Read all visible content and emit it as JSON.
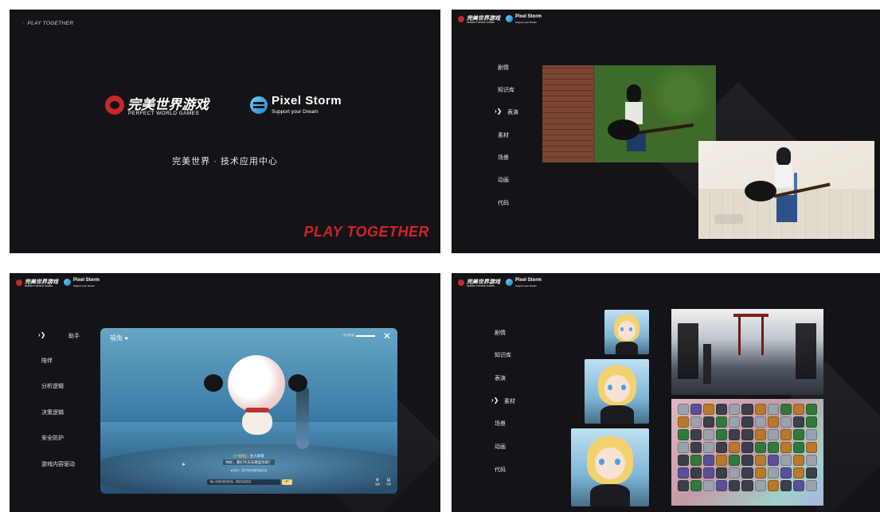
{
  "slide1": {
    "tag": "PLAY TOGETHER",
    "pw_cn": "完美世界游戏",
    "pw_en": "PERFECT WORLD GAMES",
    "ps_en": "Pixel Storm",
    "ps_slogan": "Support your Dream",
    "subtitle": "完美世界 · 技术应用中心",
    "big_tag": "PLAY TOGETHER"
  },
  "mini_header": {
    "pw_cn": "完美世界游戏",
    "pw_en": "PERFECT WORLD GAMES",
    "ps_en": "Pixel Storm",
    "ps_slogan": "Support your Dream"
  },
  "slide2": {
    "menu": [
      "剧情",
      "知识库",
      "表演",
      "素材",
      "场景",
      "动画",
      "代码"
    ]
  },
  "slide3": {
    "menu": [
      "助手",
      "陪伴",
      "分析逻辑",
      "决策逻辑",
      "安全防护",
      "游戏内容驱动"
    ],
    "game": {
      "name": "福兔 ●",
      "volume_label": "音乐音量",
      "close": "✕",
      "line1_highlight": "[小福兔]：",
      "line1_text": "主人好呀",
      "line2": "你好，我们今天去哪里玩呢？",
      "hint": "■ 提示：按下回车键开始对话",
      "chat_placeholder": "输入你想对我说的话，按回车键发送",
      "send": "↵",
      "icon_a_label": "设置",
      "icon_b_label": "记录"
    }
  },
  "slide4": {
    "menu": [
      "剧情",
      "知识库",
      "表演",
      "素材",
      "场景",
      "动画",
      "代码"
    ]
  },
  "colors": {
    "background": "#141317",
    "brand_red": "#c8262b",
    "accent_yellow": "#f7d76b"
  }
}
